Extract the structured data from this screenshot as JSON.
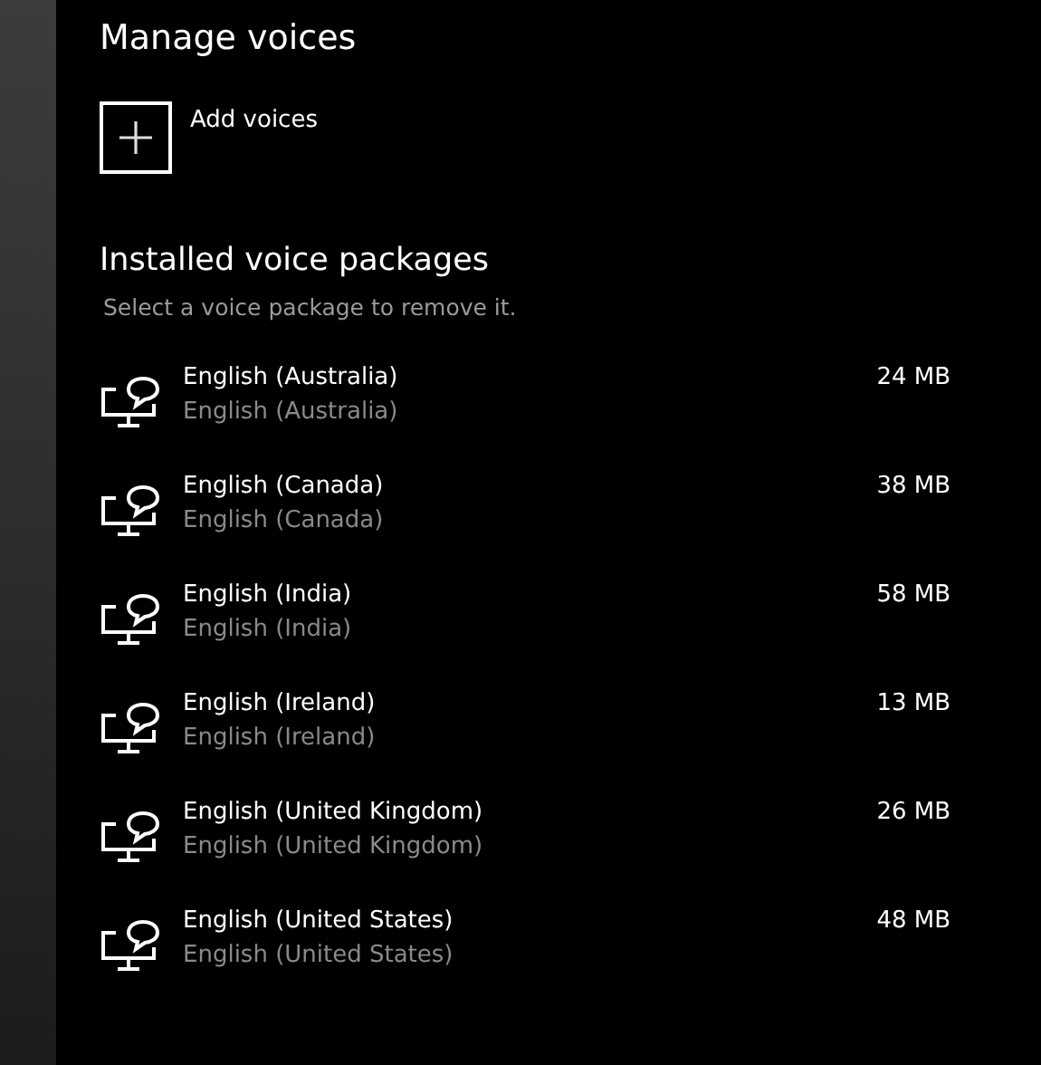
{
  "title": "Manage voices",
  "add_button": {
    "label": "Add voices"
  },
  "installed": {
    "heading": "Installed voice packages",
    "hint": "Select a voice package to remove it.",
    "packages": [
      {
        "name": "English (Australia)",
        "subtitle": "English (Australia)",
        "size": "24 MB"
      },
      {
        "name": "English (Canada)",
        "subtitle": "English (Canada)",
        "size": "38 MB"
      },
      {
        "name": "English (India)",
        "subtitle": "English (India)",
        "size": "58 MB"
      },
      {
        "name": "English (Ireland)",
        "subtitle": "English (Ireland)",
        "size": "13 MB"
      },
      {
        "name": "English (United Kingdom)",
        "subtitle": "English (United Kingdom)",
        "size": "26 MB"
      },
      {
        "name": "English (United States)",
        "subtitle": "English (United States)",
        "size": "48 MB"
      }
    ]
  }
}
